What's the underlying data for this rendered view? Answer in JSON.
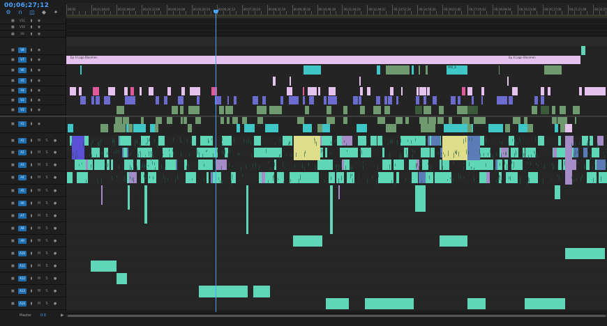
{
  "timecode": "00;06;27;12",
  "tools": [
    {
      "icon": "nest-sequence-icon"
    },
    {
      "icon": "snap-magnet-icon"
    },
    {
      "icon": "linked-selection-icon"
    },
    {
      "icon": "add-marker-icon"
    },
    {
      "icon": "wrench-settings-icon"
    }
  ],
  "ruler_labels": [
    "00;00",
    "00;01;04;02",
    "00;02;08;04",
    "00;03;12;06",
    "00;04;16;08",
    "00;05;20;10",
    "00;06;24;12",
    "00;07;28;14",
    "00;08;32;16",
    "00;09;36;18",
    "00;10;40;18",
    "00;11;44;20",
    "00;12;48;22",
    "00;13;52;24",
    "00;14;56;26",
    "00;16;01;00",
    "00;17;05;02",
    "00;18;09;04",
    "00;19;13;06",
    "00;20;17;08",
    "00;21;21;08",
    "00;22;25;10"
  ],
  "video_tracks": [
    {
      "label": "V11",
      "target": false
    },
    {
      "label": "V10",
      "target": false
    },
    {
      "label": "V9",
      "target": false
    },
    {
      "label": "V8",
      "target": true
    },
    {
      "label": "V7",
      "target": true
    },
    {
      "label": "V6",
      "target": true
    },
    {
      "label": "V5",
      "target": true
    },
    {
      "label": "V4",
      "target": true
    },
    {
      "label": "V3",
      "target": true
    },
    {
      "label": "V2",
      "target": true
    },
    {
      "label": "V1",
      "target": true
    }
  ],
  "audio_tracks": [
    {
      "label": "A1"
    },
    {
      "label": "A2"
    },
    {
      "label": "A3"
    },
    {
      "label": "A4"
    },
    {
      "label": "A5"
    },
    {
      "label": "A6"
    },
    {
      "label": "A7"
    },
    {
      "label": "A8"
    },
    {
      "label": "A9"
    },
    {
      "label": "A10"
    },
    {
      "label": "A11"
    },
    {
      "label": "A12"
    },
    {
      "label": "A13"
    },
    {
      "label": "A14"
    }
  ],
  "audio_buttons": {
    "mute": "M",
    "solo": "S"
  },
  "master": {
    "label": "Master",
    "value": "0.0"
  },
  "clip_labels": {
    "title_clip": "Ep 4 Logo Bloomen",
    "title_clip_end": "Ep 4 Logo Bloomen",
    "v7_mid": "MVI_8"
  },
  "colors": {
    "accent": "#4aa3ff",
    "clip_cyan": "#3fc6c6",
    "clip_green": "#6f9a6f",
    "clip_pink": "#e6c3ee",
    "clip_purple": "#6c6cd0",
    "clip_audio": "#5fd6b6",
    "clip_yellow": "#dede8a",
    "clip_blue": "#5a7bb5",
    "clip_lilac": "#a58cc8"
  }
}
